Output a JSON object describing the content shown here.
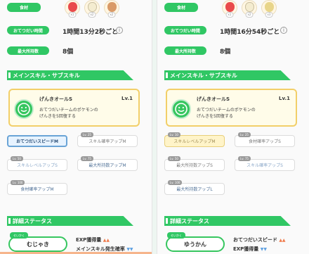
{
  "left": {
    "top_label": "食材",
    "ingredients": [
      {
        "icon": "apple-icon",
        "color": "#e94b4b",
        "badge": "x1"
      },
      {
        "icon": "milk-icon",
        "color": "#f4ecd0",
        "badge": "x2"
      },
      {
        "icon": "potato-icon",
        "color": "#d99a67",
        "badge": "x2"
      }
    ],
    "help_time_label": "おてつだい時間",
    "help_time_value": "1時間13分2秒ごと",
    "max_carry_label": "最大所持数",
    "max_carry_value": "8個",
    "section_skills": "メインスキル・サブスキル",
    "main_skill": {
      "name": "げんきオールS",
      "level": "Lv.1",
      "desc_line1": "おてつだいチームのポケモンの",
      "desc_line2": "げんきを5回復する"
    },
    "sub_skills": [
      {
        "label": "おてつだいスピードM",
        "lvbadge": "",
        "style": "active"
      },
      {
        "label": "スキル確率アップM",
        "lvbadge": "Lv. 25",
        "style": "plain"
      },
      {
        "label": "スキルレベルアップS",
        "lvbadge": "Lv. 50",
        "style": "blue"
      },
      {
        "label": "最大所持数アップM",
        "lvbadge": "Lv. 75",
        "style": "strong"
      },
      {
        "label": "食材確率アップM",
        "lvbadge": "Lv. 100",
        "style": "strong"
      }
    ],
    "section_detail": "詳細ステータス",
    "nature_tag": "せいかく",
    "nature": "むじゃき",
    "stat1": "EXP獲得量",
    "stat1_arrows": "▲▲",
    "stat2": "メインスキル発生確率",
    "stat2_arrows": "▼▼"
  },
  "right": {
    "top_label": "食材",
    "ingredients": [
      {
        "icon": "apple-icon",
        "color": "#e94b4b",
        "badge": "x1"
      },
      {
        "icon": "milk-icon",
        "color": "#f4ecd0",
        "badge": "x2"
      },
      {
        "icon": "drink-icon",
        "color": "#e8d58a",
        "badge": "x3"
      }
    ],
    "help_time_label": "おてつだい時間",
    "help_time_value": "1時間16分54秒ごと",
    "max_carry_label": "最大所持数",
    "max_carry_value": "8個",
    "section_skills": "メインスキル・サブスキル",
    "main_skill": {
      "name": "げんきオールS",
      "level": "Lv.1",
      "desc_line1": "おてつだいチームのポケモンの",
      "desc_line2": "げんきを5回復する"
    },
    "sub_skills": [
      {
        "label": "スキルレベルアップM",
        "lvbadge": "Lv. 10",
        "style": "gold"
      },
      {
        "label": "食材確率アップS",
        "lvbadge": "Lv. 25",
        "style": "plain"
      },
      {
        "label": "最大所持数アップS",
        "lvbadge": "Lv. 50",
        "style": "plain"
      },
      {
        "label": "スキル確率アップS",
        "lvbadge": "Lv. 75",
        "style": "blue"
      },
      {
        "label": "最大所持数アップL",
        "lvbadge": "Lv. 100",
        "style": "strong"
      }
    ],
    "section_detail": "詳細ステータス",
    "nature_tag": "せいかく",
    "nature": "ゆうかん",
    "stat1": "おてつだいスピード",
    "stat1_arrows": "▲▲",
    "stat2": "EXP獲得量",
    "stat2_arrows": "▼▼"
  }
}
